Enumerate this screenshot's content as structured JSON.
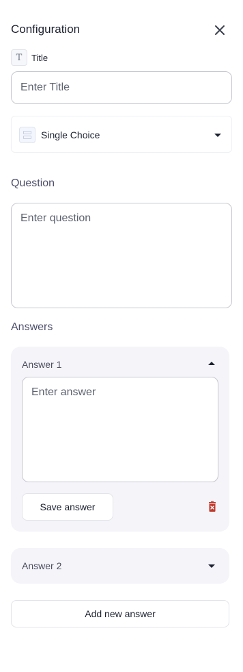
{
  "header": {
    "title": "Configuration",
    "close_icon": "close-icon"
  },
  "title_field": {
    "chip_letter": "T",
    "label": "Title",
    "placeholder": "Enter Title",
    "value": ""
  },
  "type_select": {
    "value": "Single Choice",
    "icon": "single-choice-icon"
  },
  "question": {
    "label": "Question",
    "placeholder": "Enter question",
    "value": ""
  },
  "answers": {
    "label": "Answers",
    "items": [
      {
        "title": "Answer 1",
        "expanded": true,
        "placeholder": "Enter answer",
        "value": "",
        "save_label": "Save answer"
      },
      {
        "title": "Answer 2",
        "expanded": false
      }
    ],
    "add_label": "Add new answer"
  },
  "colors": {
    "delete": "#c0392b",
    "card_bg": "#f4f4f9",
    "section_label": "#4e4f6b"
  }
}
